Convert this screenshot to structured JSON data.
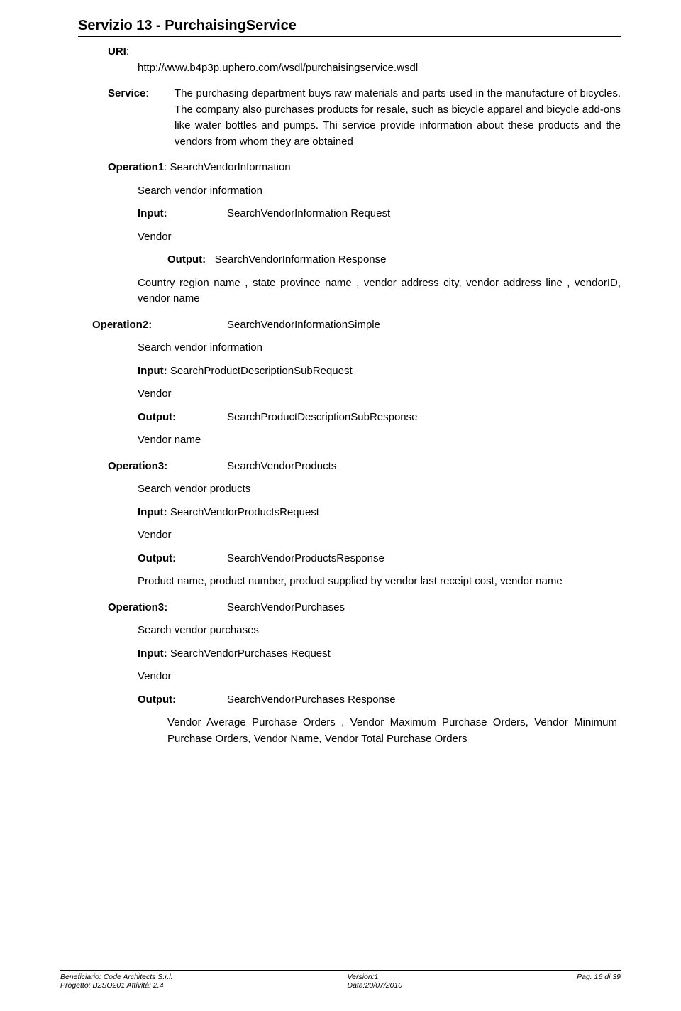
{
  "title": "Servizio 13 - PurchaisingService",
  "uri_label": "URI",
  "uri_value": "http://www.b4p3p.uphero.com/wsdl/purchaisingservice.wsdl",
  "service_label": "Service",
  "service_desc": "The purchasing department buys raw materials and parts used in the manufacture of bicycles. The company also purchases products for resale, such as bicycle apparel and bicycle add-ons like water bottles and pumps. Thi service provide information about these products and the vendors from whom they are obtained",
  "op1_label": "Operation1",
  "op1_name": "SearchVendorInformation",
  "op1_desc": "Search vendor information",
  "input_label": "Input:",
  "output_label": "Output:",
  "op1_input": "SearchVendorInformation Request",
  "op1_input_desc": "Vendor",
  "op1_output": "SearchVendorInformation Response",
  "op1_output_desc": "Country region name , state province name ,  vendor address city, vendor address line , vendorID, vendor name",
  "op2_label": "Operation2",
  "op2_name": "SearchVendorInformationSimple",
  "op2_desc": "Search vendor information",
  "op2_input_label": "Input:",
  "op2_input": "SearchProductDescriptionSubRequest",
  "op2_input_desc": "Vendor",
  "op2_output": "SearchProductDescriptionSubResponse",
  "op2_output_desc": "Vendor name",
  "op3_label": "Operation3",
  "op3_name": "SearchVendorProducts",
  "op3_desc": "Search vendor products",
  "op3_input_label": "Input:",
  "op3_input": "SearchVendorProductsRequest",
  "op3_input_desc": "Vendor",
  "op3_output": "SearchVendorProductsResponse",
  "op3_output_desc": "Product name, product number, product supplied by vendor last receipt cost, vendor name",
  "op4_label": "Operation3",
  "op4_name": "SearchVendorPurchases",
  "op4_desc": "Search vendor purchases",
  "op4_input_label": "Input:",
  "op4_input": "SearchVendorPurchases Request",
  "op4_input_desc": "Vendor",
  "op4_output": "SearchVendorPurchases Response",
  "op4_output_desc": "Vendor Average Purchase Orders , Vendor Maximum Purchase Orders, Vendor Minimum Purchase Orders, Vendor Name, Vendor Total Purchase Orders",
  "footer_left": "Beneficiario: Code Architects S.r.l.\nProgetto: B2SO201   Attività: 2.4",
  "footer_center": "Version:1\nData:20/07/2010",
  "footer_right": "Pag. 16 di 39"
}
